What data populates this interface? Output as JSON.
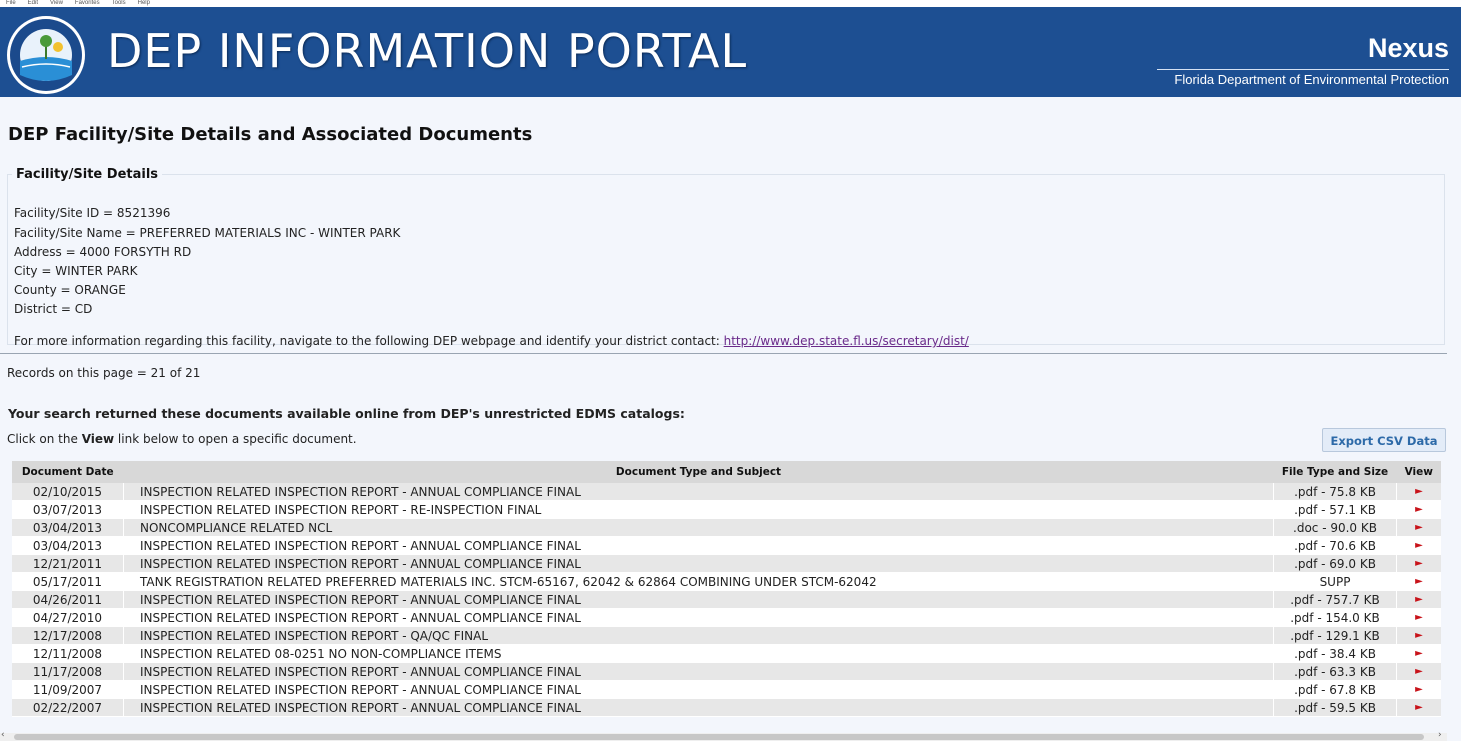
{
  "menubar": [
    "File",
    "Edit",
    "View",
    "Favorites",
    "Tools",
    "Help"
  ],
  "header": {
    "seal_text": "Florida Department of Environmental Protection",
    "portal_title": "DEP INFORMATION PORTAL",
    "nexus": "Nexus",
    "nexus_sub": "Florida Department of Environmental Protection"
  },
  "page_title": "DEP Facility/Site Details and Associated Documents",
  "details": {
    "legend": "Facility/Site Details",
    "lines": [
      "Facility/Site ID = 8521396",
      "Facility/Site Name = PREFERRED MATERIALS INC - WINTER PARK",
      "Address = 4000 FORSYTH RD",
      "City = WINTER PARK",
      "County = ORANGE",
      "District = CD"
    ],
    "more_info": "For more information regarding this facility, navigate to the following DEP webpage and identify your district contact: ",
    "link": "http://www.dep.state.fl.us/secretary/dist/"
  },
  "records": "Records on this page = 21 of 21",
  "search_message": "Your search returned these documents available online from DEP's unrestricted EDMS catalogs:",
  "click_message": {
    "prefix": "Click on the ",
    "bold": "View",
    "suffix": " link below to open a specific document."
  },
  "export_button": "Export CSV Data",
  "table": {
    "headers": [
      "Document Date",
      "Document Type and Subject",
      "File Type and Size",
      "View"
    ],
    "view_glyph": "►",
    "rows": [
      {
        "date": "02/10/2015",
        "subject": "INSPECTION RELATED INSPECTION REPORT - ANNUAL COMPLIANCE FINAL",
        "size": ".pdf  -  75.8 KB"
      },
      {
        "date": "03/07/2013",
        "subject": "INSPECTION RELATED INSPECTION REPORT - RE-INSPECTION FINAL",
        "size": ".pdf  -  57.1 KB"
      },
      {
        "date": "03/04/2013",
        "subject": "NONCOMPLIANCE RELATED NCL",
        "size": ".doc  -  90.0 KB"
      },
      {
        "date": "03/04/2013",
        "subject": "INSPECTION RELATED INSPECTION REPORT - ANNUAL COMPLIANCE FINAL",
        "size": ".pdf  -  70.6 KB"
      },
      {
        "date": "12/21/2011",
        "subject": "INSPECTION RELATED INSPECTION REPORT - ANNUAL COMPLIANCE FINAL",
        "size": ".pdf  -  69.0 KB"
      },
      {
        "date": "05/17/2011",
        "subject": "TANK REGISTRATION RELATED PREFERRED MATERIALS INC. STCM-65167, 62042 & 62864 COMBINING UNDER STCM-62042",
        "size": "SUPP"
      },
      {
        "date": "04/26/2011",
        "subject": "INSPECTION RELATED INSPECTION REPORT - ANNUAL COMPLIANCE FINAL",
        "size": ".pdf  -  757.7 KB"
      },
      {
        "date": "04/27/2010",
        "subject": "INSPECTION RELATED INSPECTION REPORT - ANNUAL COMPLIANCE FINAL",
        "size": ".pdf  -  154.0 KB"
      },
      {
        "date": "12/17/2008",
        "subject": "INSPECTION RELATED INSPECTION REPORT - QA/QC FINAL",
        "size": ".pdf  -  129.1 KB"
      },
      {
        "date": "12/11/2008",
        "subject": "INSPECTION RELATED 08-0251 NO NON-COMPLIANCE ITEMS",
        "size": ".pdf  -  38.4 KB"
      },
      {
        "date": "11/17/2008",
        "subject": "INSPECTION RELATED INSPECTION REPORT - ANNUAL COMPLIANCE FINAL",
        "size": ".pdf  -  63.3 KB"
      },
      {
        "date": "11/09/2007",
        "subject": "INSPECTION RELATED INSPECTION REPORT - ANNUAL COMPLIANCE FINAL",
        "size": ".pdf  -  67.8 KB"
      },
      {
        "date": "02/22/2007",
        "subject": "INSPECTION RELATED INSPECTION REPORT - ANNUAL COMPLIANCE FINAL",
        "size": ".pdf  -  59.5 KB"
      }
    ]
  },
  "scrollbar": {
    "left_glyph": "‹",
    "right_glyph": "›"
  },
  "colors": {
    "banner": "#1d4f92",
    "view_arrow": "#c8131a",
    "link": "#6a2a8a",
    "export_text": "#2d6aa8"
  }
}
